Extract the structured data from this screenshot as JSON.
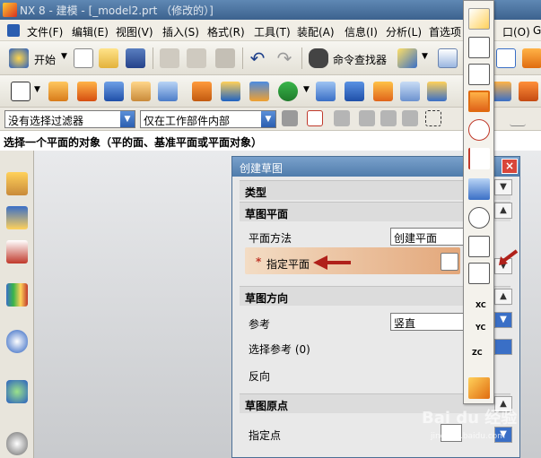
{
  "window": {
    "title": "NX 8 - 建模 - [_model2.prt （修改的）]"
  },
  "menubar": {
    "items": [
      "文件(F)",
      "编辑(E)",
      "视图(V)",
      "插入(S)",
      "格式(R)",
      "工具(T)",
      "装配(A)",
      "信息(I)",
      "分析(L)",
      "首选项",
      "口(O)",
      "G"
    ]
  },
  "toolbar": {
    "start_label": "开始",
    "command_finder_label": "命令查找器"
  },
  "selection_bar": {
    "filter_value": "没有选择过滤器",
    "scope_value": "仅在工作部件内部"
  },
  "cue_line": {
    "text": "选择一个平面的对象（平的面、基准平面或平面对象）"
  },
  "dialog": {
    "title": "创建草图",
    "close_label": "×",
    "type_group": "类型",
    "plane_group": "草图平面",
    "plane_method_label": "平面方法",
    "plane_method_value": "创建平面",
    "specify_plane_star": "*",
    "specify_plane_label": "指定平面",
    "orientation_group": "草图方向",
    "reference_label": "参考",
    "reference_value": "竖直",
    "select_reference_label": "选择参考 (0)",
    "reverse_label": "反向",
    "origin_group": "草图原点",
    "specify_point_label": "指定点"
  },
  "plane_flyout": {
    "items": [
      "自动判断",
      "二等分",
      "曲线和点",
      "两直线",
      "相切",
      "通过对象",
      "点和方向",
      "曲线上",
      "YC-ZC 平面",
      "XC-ZC 平面",
      "XY 平面",
      "视图平面",
      "按系数"
    ],
    "axis_labels": [
      "XC",
      "YC",
      "ZC"
    ]
  },
  "watermark": {
    "text": "Bai du 经验",
    "sub": "jingyan.baidu.com"
  },
  "colors": {
    "title_bar": "#4f7cab",
    "highlight": "#e3a77a",
    "arrow": "#b0201a",
    "accent": "#2c5fb0"
  }
}
